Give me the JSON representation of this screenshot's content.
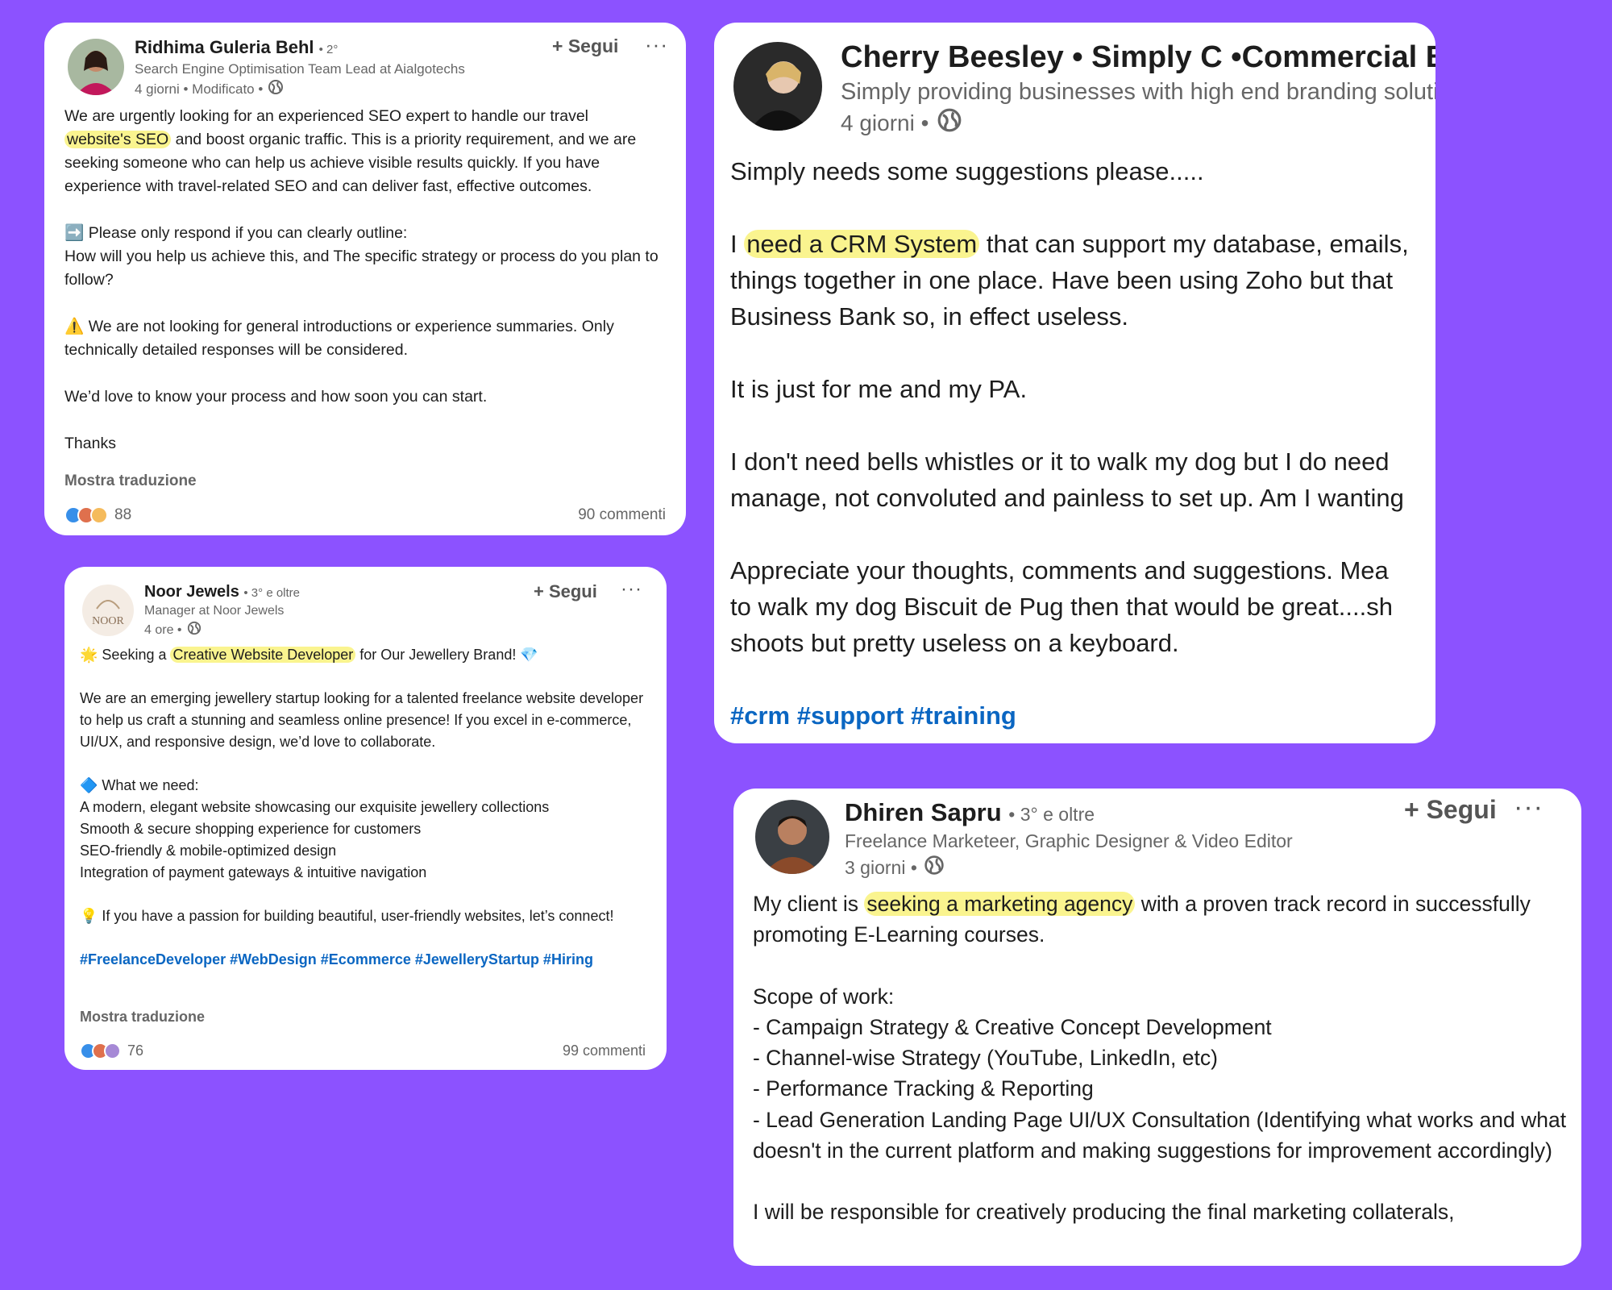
{
  "colors": {
    "background": "#8C52FF",
    "highlight": "#FAF48F",
    "link": "#0A66C2"
  },
  "post1": {
    "author": "Ridhima Guleria Behl",
    "degree": "• 2°",
    "headline": "Search Engine Optimisation Team Lead at Aialgotechs",
    "meta": "4 giorni • Modificato •",
    "follow_label": "+ Segui",
    "more_label": "···",
    "body": {
      "l1": "We are urgently looking for an experienced SEO expert to handle our travel",
      "l2_hl": "website's SEO",
      "l2_rest": " and boost organic traffic. This is a priority requirement, and we are seeking someone who can help us achieve visible results quickly. If you have experience with travel-related SEO and can deliver fast, effective outcomes.",
      "arrow_icon": "➡️",
      "p2": " Please only respond if you can clearly outline:\nHow will you help us achieve this, and The specific strategy or process do you plan to follow?",
      "warn_icon": "⚠️",
      "p3": " We are not looking for general introductions or experience summaries. Only technically detailed responses will be considered.",
      "p4": "We’d love to know your process and how soon you can start.",
      "p5": "Thanks"
    },
    "translate": "Mostra traduzione",
    "reactions": "88",
    "comments": "90 commenti"
  },
  "post2": {
    "author": "Cherry Beesley • Simply C •Commercial Bra",
    "headline": "Simply providing businesses with high end branding soluti",
    "meta": "4 giorni •",
    "body": {
      "p1": "Simply needs some suggestions please.....",
      "p2_pre": "I ",
      "p2_hl": "need a CRM System",
      "p2_rest": " that can support my database, emails,\nthings together in one place. Have been using Zoho but that\nBusiness Bank so, in effect useless.",
      "p3": "It is just for me and my PA.",
      "p4": "I don't need bells whistles or it to walk my dog but I do need\nmanage, not convoluted and painless to set up. Am I wanting",
      "p5": "Appreciate your thoughts, comments and suggestions. Mea\nto walk my dog Biscuit de Pug then that would be great....sh\nshoots but pretty useless on a keyboard."
    },
    "hashtags": "#crm #support #training"
  },
  "post3": {
    "author": "Noor Jewels",
    "degree": "• 3° e oltre",
    "headline": "Manager at Noor Jewels",
    "meta": "4 ore •",
    "logo_text": "NOOR",
    "follow_label": "+ Segui",
    "more_label": "···",
    "body": {
      "star_icon": "🌟",
      "l1_pre": " Seeking a ",
      "l1_hl": "Creative Website Developer",
      "l1_rest": " for Our Jewellery Brand! ",
      "gem_icon": "💎",
      "p2": "We are an emerging jewellery startup looking for a talented freelance website developer to help us craft a stunning and seamless online presence! If you excel in e-commerce, UI/UX, and responsive design, we’d love to collaborate.",
      "diamond_icon": "🔷",
      "p3": " What we need:\nA modern, elegant website showcasing our exquisite jewellery collections\nSmooth & secure shopping experience for customers\nSEO-friendly & mobile-optimized design\nIntegration of payment gateways & intuitive navigation",
      "bulb_icon": "💡",
      "p4": " If you have a passion for building beautiful, user-friendly websites, let’s connect!"
    },
    "hashtags": "#FreelanceDeveloper #WebDesign #Ecommerce #JewelleryStartup #Hiring",
    "translate": "Mostra traduzione",
    "reactions": "76",
    "comments": "99 commenti"
  },
  "post4": {
    "author": "Dhiren Sapru",
    "degree": "• 3° e oltre",
    "headline": "Freelance Marketeer, Graphic Designer & Video Editor",
    "meta": "3 giorni •",
    "follow_label": "+ Segui",
    "more_label": "···",
    "body": {
      "p1_pre": "My client is ",
      "p1_hl": "seeking a marketing agency",
      "p1_rest": " with a proven track record in successfully promoting E-Learning courses.",
      "p2": "Scope of work:\n- Campaign Strategy & Creative Concept Development\n- Channel-wise Strategy (YouTube, LinkedIn, etc)\n- Performance Tracking & Reporting\n- Lead Generation Landing Page UI/UX Consultation (Identifying what works and what doesn't in the current platform and making suggestions for improvement accordingly)",
      "p3": "I will be responsible for creatively producing the final marketing collaterals,"
    }
  }
}
